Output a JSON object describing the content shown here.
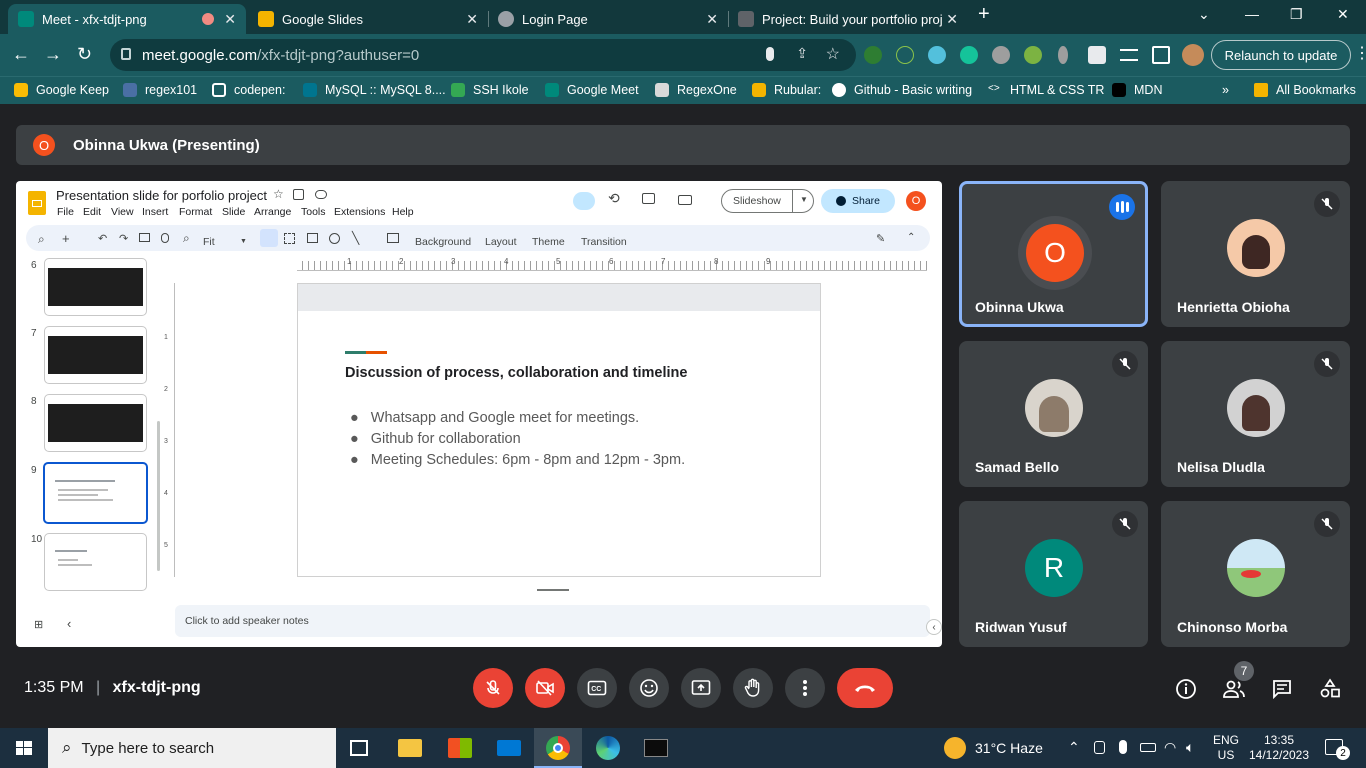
{
  "tabs": [
    {
      "title": "Meet - xfx-tdjt-png",
      "color": "#00897b"
    },
    {
      "title": "Google Slides",
      "color": "#f4b400"
    },
    {
      "title": "Login Page",
      "color": "#9aa0a6"
    },
    {
      "title": "Project: Build your portfolio proj",
      "color": "#5f6368"
    }
  ],
  "address": {
    "host": "meet.google.com",
    "path": "/xfx-tdjt-png?authuser=0"
  },
  "relaunch_label": "Relaunch to update",
  "bookmarks": [
    {
      "label": "Google Keep",
      "color": "#fbbc04"
    },
    {
      "label": "regex101",
      "color": "#4a6fa5"
    },
    {
      "label": "codepen:",
      "color": "#ffffff"
    },
    {
      "label": "MySQL :: MySQL 8....",
      "color": "#00758f"
    },
    {
      "label": "SSH Ikole",
      "color": "#34a853"
    },
    {
      "label": "Google Meet",
      "color": "#00897b"
    },
    {
      "label": "RegexOne",
      "color": "#d9d9d9"
    },
    {
      "label": "Rubular:",
      "color": "#f4b400"
    },
    {
      "label": "Github - Basic writing",
      "color": "#ffffff"
    },
    {
      "label": "HTML & CSS TR",
      "color": "#cfd8dc"
    },
    {
      "label": "MDN",
      "color": "#000000"
    }
  ],
  "all_bookmarks": "All Bookmarks",
  "presenter": {
    "initial": "O",
    "banner": "Obinna Ukwa (Presenting)"
  },
  "slides_app": {
    "doc_title": "Presentation slide for porfolio project",
    "menu": [
      "File",
      "Edit",
      "View",
      "Insert",
      "Format",
      "Slide",
      "Arrange",
      "Tools",
      "Extensions",
      "Help"
    ],
    "zoom": "Fit",
    "toolbar_items": [
      "Background",
      "Layout",
      "Theme",
      "Transition"
    ],
    "slideshow": "Slideshow",
    "share": "Share",
    "avatar": "O",
    "ruler": [
      "1",
      "2",
      "3",
      "4",
      "5",
      "6",
      "7",
      "8",
      "9"
    ],
    "vruler": [
      "1",
      "2",
      "3",
      "4",
      "5"
    ],
    "thumb_numbers": [
      "6",
      "7",
      "8",
      "9",
      "10"
    ],
    "slide": {
      "heading": "Discussion of process, collaboration and timeline",
      "bullets": [
        "Whatsapp and Google meet for meetings.",
        "Github for collaboration",
        "Meeting Schedules:  6pm - 8pm and 12pm - 3pm."
      ]
    },
    "speaker_notes": "Click to add speaker notes"
  },
  "participants": [
    {
      "name": "Obinna Ukwa",
      "initial": "O",
      "color": "#f4511e"
    },
    {
      "name": "Henrietta Obioha",
      "initial": "",
      "color": "#f5c9a8"
    },
    {
      "name": "Samad Bello",
      "initial": "",
      "color": "#d9d4cc"
    },
    {
      "name": "Nelisa Dludla",
      "initial": "",
      "color": "#d2d2d2"
    },
    {
      "name": "Ridwan Yusuf",
      "initial": "R",
      "color": "#00897b"
    },
    {
      "name": "Chinonso Morba",
      "initial": "",
      "color": "#8fc77a"
    }
  ],
  "meeting": {
    "time": "1:35 PM",
    "code": "xfx-tdjt-png",
    "people_count": "7"
  },
  "taskbar": {
    "search": "Type here to search",
    "weather": "31°C  Haze",
    "lang1": "ENG",
    "lang2": "US",
    "time": "13:35",
    "date": "14/12/2023",
    "notif": "2"
  }
}
